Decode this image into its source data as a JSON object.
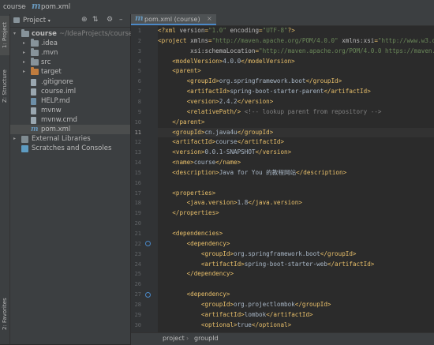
{
  "breadcrumb": {
    "project": "course",
    "separator": "›",
    "file": "pom.xml"
  },
  "left_tools": {
    "project_tab": "1: Project",
    "structure_tab": "Z: Structure",
    "favorites_tab": "2: Favorites"
  },
  "project_panel": {
    "title": "Project",
    "tree": [
      {
        "label": "course",
        "extra": "~/IdeaProjects/course",
        "kind": "root-folder",
        "depth": 0,
        "arrow": "▾"
      },
      {
        "label": ".idea",
        "kind": "folder",
        "depth": 1,
        "arrow": "▸"
      },
      {
        "label": ".mvn",
        "kind": "folder",
        "depth": 1,
        "arrow": "▸"
      },
      {
        "label": "src",
        "kind": "folder",
        "depth": 1,
        "arrow": "▸"
      },
      {
        "label": "target",
        "kind": "folder-orange",
        "depth": 1,
        "arrow": "▸"
      },
      {
        "label": ".gitignore",
        "kind": "file",
        "depth": 1
      },
      {
        "label": "course.iml",
        "kind": "file",
        "depth": 1
      },
      {
        "label": "HELP.md",
        "kind": "file-md",
        "depth": 1
      },
      {
        "label": "mvnw",
        "kind": "file",
        "depth": 1
      },
      {
        "label": "mvnw.cmd",
        "kind": "file",
        "depth": 1
      },
      {
        "label": "pom.xml",
        "kind": "file-maven",
        "depth": 1,
        "selected": true
      },
      {
        "label": "External Libraries",
        "kind": "library",
        "depth": 0,
        "arrow": "▸"
      },
      {
        "label": "Scratches and Consoles",
        "kind": "scratch",
        "depth": 0
      }
    ]
  },
  "editor": {
    "tab_label": "pom.xml (course)",
    "line_numbers": [
      "1",
      "2",
      "3",
      "4",
      "5",
      "6",
      "7",
      "8",
      "9",
      "10",
      "11",
      "12",
      "13",
      "14",
      "15",
      "16",
      "17",
      "18",
      "19",
      "20",
      "21",
      "22",
      "23",
      "24",
      "25",
      "26",
      "27",
      "28",
      "29",
      "30",
      "31"
    ],
    "active_line": 11,
    "gutter_markers": [
      22,
      27
    ],
    "lines": [
      "<?xml version=\"1.0\" encoding=\"UTF-8\"?>",
      "<project xmlns=\"http://maven.apache.org/POM/4.0.0\" xmlns:xsi=\"http://www.w3.org/2001/XMLSchema-instance\"",
      "         xsi:schemaLocation=\"http://maven.apache.org/POM/4.0.0 https://maven.apache.org/xsd/maven-4.0.0.xsd\">",
      "    <modelVersion>4.0.0</modelVersion>",
      "    <parent>",
      "        <groupId>org.springframework.boot</groupId>",
      "        <artifactId>spring-boot-starter-parent</artifactId>",
      "        <version>2.4.2</version>",
      "        <relativePath/> <!-- lookup parent from repository -->",
      "    </parent>",
      "    <groupId>cn.java4u</groupId>",
      "    <artifactId>course</artifactId>",
      "    <version>0.0.1-SNAPSHOT</version>",
      "    <name>course</name>",
      "    <description>Java for You 的教程网站</description>",
      "",
      "    <properties>",
      "        <java.version>1.8</java.version>",
      "    </properties>",
      "",
      "    <dependencies>",
      "        <dependency>",
      "            <groupId>org.springframework.boot</groupId>",
      "            <artifactId>spring-boot-starter-web</artifactId>",
      "        </dependency>",
      "",
      "        <dependency>",
      "            <groupId>org.projectlombok</groupId>",
      "            <artifactId>lombok</artifactId>",
      "            <optional>true</optional>",
      "        </dependency>"
    ]
  },
  "statusbar": {
    "path1": "project",
    "path2": "groupId",
    "separator": "›"
  },
  "colors": {
    "accent": "#4a88c7",
    "tag": "#e8bf6a",
    "string": "#6a8759",
    "comment": "#808080",
    "folder": "#87939a",
    "target_folder": "#c07c3e"
  }
}
